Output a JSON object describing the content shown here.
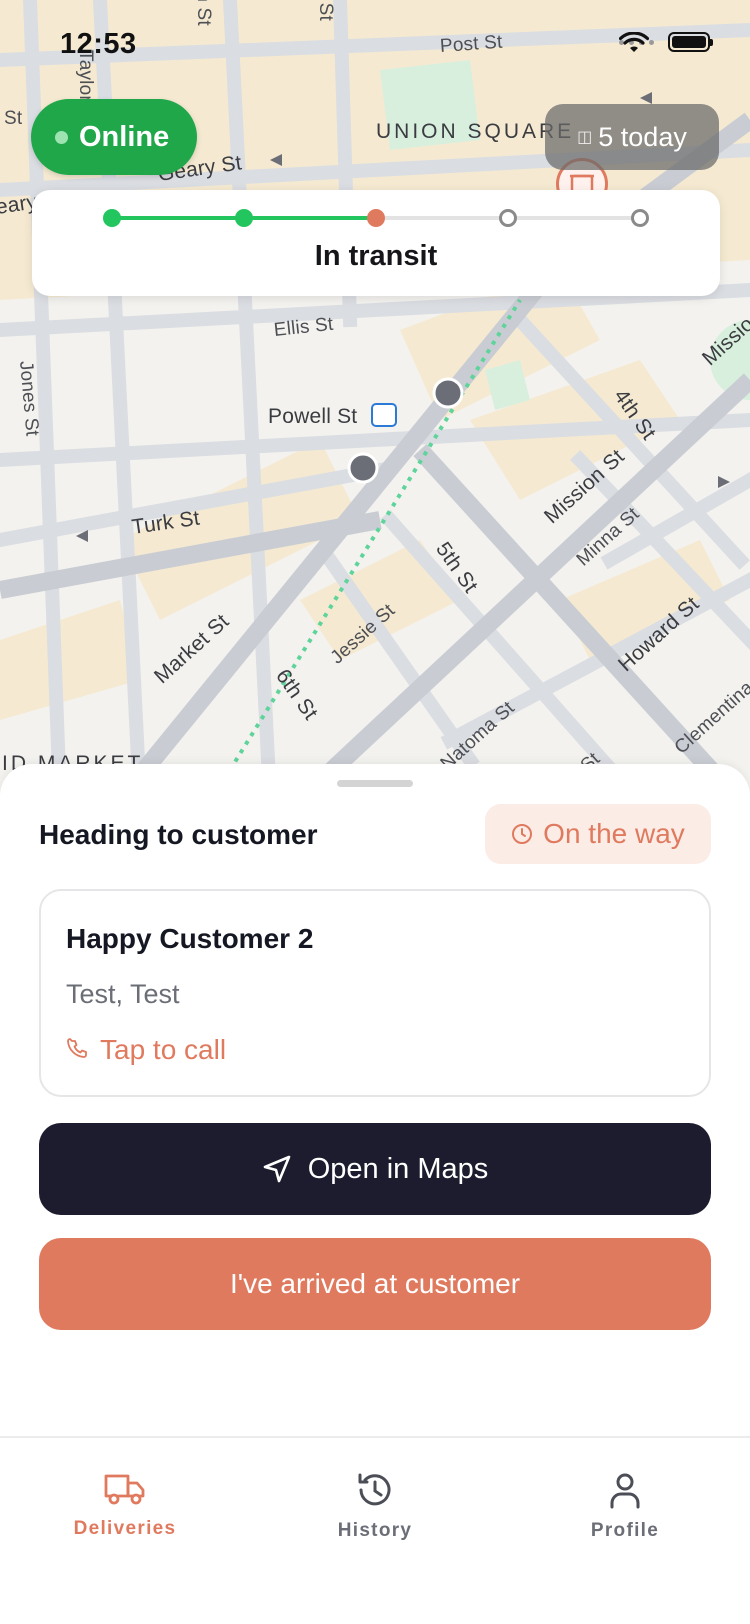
{
  "status_bar": {
    "time": "12:53"
  },
  "map": {
    "labels": {
      "post": "Post St",
      "union_square": "UNION SQUARE",
      "geary": "Geary St",
      "geary_left": "eary St",
      "st_left": "St",
      "taylor": "Taylor St",
      "mason": "Mason St",
      "powell_top": "Powell St",
      "ellis": "Ellis St",
      "jones": "Jones St",
      "powell": "Powell St",
      "turk": "Turk St",
      "market": "Market St",
      "fifth": "5th St",
      "fourth": "4th St",
      "mission": "Mission St",
      "mission_right": "Missio",
      "minna": "Minna St",
      "jessie": "Jessie St",
      "sixth": "6th St",
      "howard": "Howard St",
      "natoma": "Natoma St",
      "clementina": "Clementina",
      "st_bottom": "St",
      "mid_market": "ID MARKET"
    }
  },
  "online": {
    "label": "Online"
  },
  "today": {
    "label": "5 today"
  },
  "progress": {
    "label": "In transit",
    "steps": [
      "done",
      "done",
      "current",
      "todo",
      "todo"
    ]
  },
  "sheet": {
    "title": "Heading to customer",
    "badge": "On the way",
    "customer": {
      "name": "Happy Customer 2",
      "address": "Test, Test",
      "call": "Tap to call"
    },
    "maps_button": "Open in Maps",
    "arrived_button": "I've arrived at customer"
  },
  "tabs": [
    {
      "label": "Deliveries",
      "icon": "truck-icon",
      "active": true
    },
    {
      "label": "History",
      "icon": "history-icon",
      "active": false
    },
    {
      "label": "Profile",
      "icon": "person-icon",
      "active": false
    }
  ],
  "colors": {
    "accent": "#e07a5f",
    "online": "#1fa74a",
    "progress_done": "#22c55e",
    "dark_button": "#1c1c2e"
  }
}
